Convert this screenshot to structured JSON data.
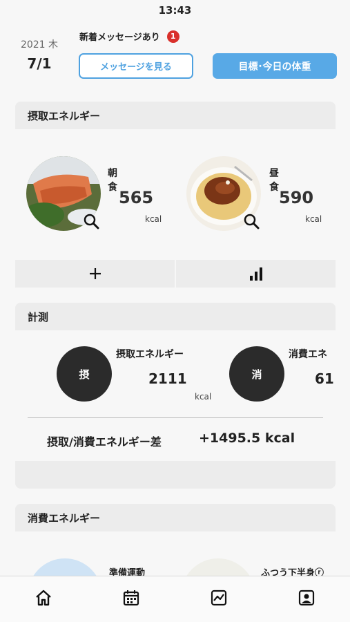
{
  "status": {
    "time": "13:43"
  },
  "date": {
    "year_weekday": "2021 木",
    "day": "7/1"
  },
  "messages": {
    "notice": "新着メッセージあり",
    "count": "1",
    "view_button": "メッセージを見る"
  },
  "goal_button": "目標･今日の体重",
  "intake": {
    "header": "摂取エネルギー",
    "meals": [
      {
        "name": "朝食",
        "kcal": "565",
        "unit": "kcal"
      },
      {
        "name": "昼食",
        "kcal": "590",
        "unit": "kcal"
      }
    ]
  },
  "actions": {
    "add_icon": "plus-icon",
    "chart_icon": "bar-chart-icon"
  },
  "measurement": {
    "header": "計測",
    "items": [
      {
        "badge": "摂",
        "label": "摂取エネルギー",
        "value": "2111",
        "unit": "kcal"
      },
      {
        "badge": "消",
        "label": "消費エネ",
        "value": "61",
        "unit": ""
      }
    ],
    "diff_label": "摂取/消費エネルギー差",
    "diff_value": "+1495.5 kcal"
  },
  "expenditure": {
    "header": "消費エネルギー",
    "items": [
      {
        "name": "準備運動",
        "color": "#cfe3f5"
      },
      {
        "name": "ふつう下半身ⓡ",
        "color": "#efefe9"
      }
    ]
  },
  "tabbar": [
    "home-icon",
    "calendar-icon",
    "trend-chart-icon",
    "profile-icon"
  ]
}
